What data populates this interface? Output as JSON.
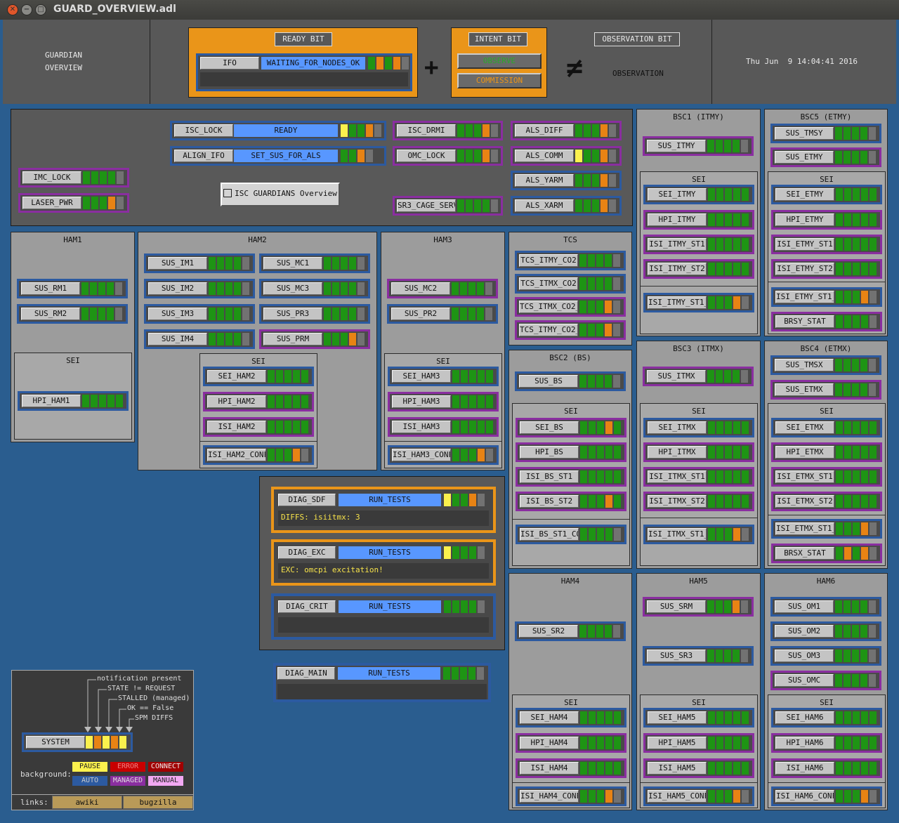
{
  "window": {
    "title": "GUARD_OVERVIEW.adl"
  },
  "header": {
    "title_line1": "GUARDIAN",
    "title_line2": "OVERVIEW",
    "ready_bit": "READY BIT",
    "intent_bit": "INTENT BIT",
    "observation_bit": "OBSERVATION BIT",
    "plus": "+",
    "not_equal": "≠",
    "observe": "OBSERVE",
    "commission": "COMMISSION",
    "observation": "OBSERVATION",
    "datetime": "Thu Jun  9 14:04:41 2016",
    "ifo_label": "IFO",
    "ifo_state": "WAITING_FOR_NODES_OK"
  },
  "panels": {
    "ham1": "HAM1",
    "ham2": "HAM2",
    "ham3": "HAM3",
    "tcs": "TCS",
    "bsc1": "BSC1 (ITMY)",
    "bsc5": "BSC5 (ETMY)",
    "bsc2": "BSC2 (BS)",
    "bsc3": "BSC3 (ITMX)",
    "bsc4": "BSC4 (ETMX)",
    "ham4": "HAM4",
    "ham5": "HAM5",
    "ham6": "HAM6",
    "sei": "SEI"
  },
  "isc_button": "ISC GUARDIANS Overview",
  "nodes": {
    "isc_lock": "ISC_LOCK",
    "isc_lock_state": "READY",
    "align_ifo": "ALIGN_IFO",
    "align_ifo_state": "SET_SUS_FOR_ALS",
    "isc_drmi": "ISC_DRMI",
    "omc_lock": "OMC_LOCK",
    "sr3_cage": "SR3_CAGE_SERVO",
    "als_diff": "ALS_DIFF",
    "als_comm": "ALS_COMM",
    "als_yarm": "ALS_YARM",
    "als_xarm": "ALS_XARM",
    "imc_lock": "IMC_LOCK",
    "laser_pwr": "LASER_PWR",
    "sus_rm1": "SUS_RM1",
    "sus_rm2": "SUS_RM2",
    "hpi_ham1": "HPI_HAM1",
    "sus_im1": "SUS_IM1",
    "sus_im2": "SUS_IM2",
    "sus_im3": "SUS_IM3",
    "sus_im4": "SUS_IM4",
    "sus_mc1": "SUS_MC1",
    "sus_mc3": "SUS_MC3",
    "sus_pr3": "SUS_PR3",
    "sus_prm": "SUS_PRM",
    "sei_ham2": "SEI_HAM2",
    "hpi_ham2": "HPI_HAM2",
    "isi_ham2": "ISI_HAM2",
    "isi_ham2_conf": "ISI_HAM2_CONF",
    "sus_mc2": "SUS_MC2",
    "sus_pr2": "SUS_PR2",
    "sei_ham3": "SEI_HAM3",
    "hpi_ham3": "HPI_HAM3",
    "isi_ham3": "ISI_HAM3",
    "isi_ham3_conf": "ISI_HAM3_CONF",
    "tcs_itmy_co2": "TCS_ITMY_CO2",
    "tcs_itmx_co2": "TCS_ITMX_CO2",
    "tcs_itmx_co2_pwr": "TCS_ITMX_CO2_PWR",
    "tcs_itmy_co2_pwr": "TCS_ITMY_CO2_PWR",
    "sus_bs": "SUS_BS",
    "sei_bs": "SEI_BS",
    "hpi_bs": "HPI_BS",
    "isi_bs_st1": "ISI_BS_ST1",
    "isi_bs_st2": "ISI_BS_ST2",
    "isi_bs_st1_conf": "ISI_BS_ST1_CONF",
    "sus_itmy": "SUS_ITMY",
    "sei_itmy": "SEI_ITMY",
    "hpi_itmy": "HPI_ITMY",
    "isi_itmy_st1": "ISI_ITMY_ST1",
    "isi_itmy_st2": "ISI_ITMY_ST2",
    "isi_itmy_st1_conf": "ISI_ITMY_ST1_CONF",
    "sus_tmsy": "SUS_TMSY",
    "sus_etmy": "SUS_ETMY",
    "sei_etmy": "SEI_ETMY",
    "hpi_etmy": "HPI_ETMY",
    "isi_etmy_st1": "ISI_ETMY_ST1",
    "isi_etmy_st2": "ISI_ETMY_ST2",
    "isi_etmy_st1_conf": "ISI_ETMY_ST1_CONF",
    "brsy_stat": "BRSY_STAT",
    "sus_itmx": "SUS_ITMX",
    "sei_itmx": "SEI_ITMX",
    "hpi_itmx": "HPI_ITMX",
    "isi_itmx_st1": "ISI_ITMX_ST1",
    "isi_itmx_st2": "ISI_ITMX_ST2",
    "isi_itmx_st1_conf": "ISI_ITMX_ST1_CONF",
    "sus_tmsx": "SUS_TMSX",
    "sus_etmx": "SUS_ETMX",
    "sei_etmx": "SEI_ETMX",
    "hpi_etmx": "HPI_ETMX",
    "isi_etmx_st1": "ISI_ETMX_ST1",
    "isi_etmx_st2": "ISI_ETMX_ST2",
    "isi_etmx_st1_conf": "ISI_ETMX_ST1_CONF",
    "brsx_stat": "BRSX_STAT",
    "sus_sr2": "SUS_SR2",
    "sei_ham4": "SEI_HAM4",
    "hpi_ham4": "HPI_HAM4",
    "isi_ham4": "ISI_HAM4",
    "isi_ham4_conf": "ISI_HAM4_CONF",
    "sus_srm": "SUS_SRM",
    "sus_sr3": "SUS_SR3",
    "sei_ham5": "SEI_HAM5",
    "hpi_ham5": "HPI_HAM5",
    "isi_ham5": "ISI_HAM5",
    "isi_ham5_conf": "ISI_HAM5_CONF",
    "sus_om1": "SUS_OM1",
    "sus_om2": "SUS_OM2",
    "sus_om3": "SUS_OM3",
    "sus_omc": "SUS_OMC",
    "sei_ham6": "SEI_HAM6",
    "hpi_ham6": "HPI_HAM6",
    "isi_ham6": "ISI_HAM6",
    "isi_ham6_conf": "ISI_HAM6_CONF"
  },
  "diag": {
    "sdf": "DIAG_SDF",
    "exc": "DIAG_EXC",
    "crit": "DIAG_CRIT",
    "main": "DIAG_MAIN",
    "state": "RUN_TESTS",
    "sdf_msg": "DIFFS: isiitmx: 3",
    "exc_msg": "EXC: omcpi excitation!"
  },
  "legend": {
    "l1": "notification present",
    "l2": "STATE != REQUEST",
    "l3": "STALLED (managed)",
    "l4": "OK == False",
    "l5": "SPM DIFFS",
    "system": "SYSTEM",
    "background": "background:",
    "pause": "PAUSE",
    "error": "ERROR",
    "connect": "CONNECT",
    "auto": "AUTO",
    "managed": "MANAGED",
    "manual": "MANUAL",
    "links": "links:",
    "awiki": "awiki",
    "bugzilla": "bugzilla",
    "colors": {
      "pause": "#fbf14d",
      "error": "#c80000",
      "connect": "#a00000",
      "auto": "#2c5aa0",
      "managed": "#8a2ea0",
      "manual": "#f2a8f2"
    }
  }
}
